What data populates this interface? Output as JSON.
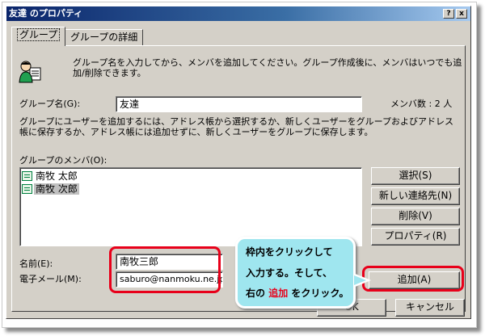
{
  "window": {
    "title": "友達 のプロパティ",
    "help_glyph": "?",
    "close_glyph": "x"
  },
  "tabs": [
    {
      "label": "グループ",
      "active": true
    },
    {
      "label": "グループの詳細",
      "active": false
    }
  ],
  "intro_text": [
    "グループ名を入力してから、メンバを追加してください。グループ作成後に、メンバはいつでも追",
    "加/削除できます。"
  ],
  "group_name": {
    "label": "グループ名(G):",
    "value": "友達",
    "member_count": "メンバ数 : 2 人"
  },
  "description": [
    "グループにユーザーを追加するには、アドレス帳から選択するか、新しくユーザーをグループおよびアドレス",
    "帳に保存するか、アドレス帳には追加せずに、新しくユーザーをグループに保存します。"
  ],
  "members": {
    "label": "グループのメンバ(O):",
    "items": [
      {
        "name": "南牧 太郎",
        "selected": false
      },
      {
        "name": "南牧 次郎",
        "selected": true
      }
    ]
  },
  "side_buttons": {
    "select": "選択(S)",
    "new_contact": "新しい連絡先(N)",
    "remove": "削除(V)",
    "properties": "プロパティ(R)"
  },
  "name_field": {
    "label": "名前(E):",
    "value": "南牧三郎"
  },
  "email_field": {
    "label": "電子メール(M):",
    "value": "saburo@nanmoku.ne.jp"
  },
  "add_button": "追加(A)",
  "ok_button": "OK",
  "cancel_button": "キャンセル",
  "callout": {
    "line1": "枠内をクリックして",
    "line2": "入力する。そして、",
    "line3_pre": "右の",
    "line3_red": "追加",
    "line3_post": "をクリック。"
  },
  "colors": {
    "highlight": "#e8001a",
    "callout_bg": "#9fe6ef",
    "title_bar": "#0a246a",
    "dialog_face": "#d4d0c8"
  }
}
